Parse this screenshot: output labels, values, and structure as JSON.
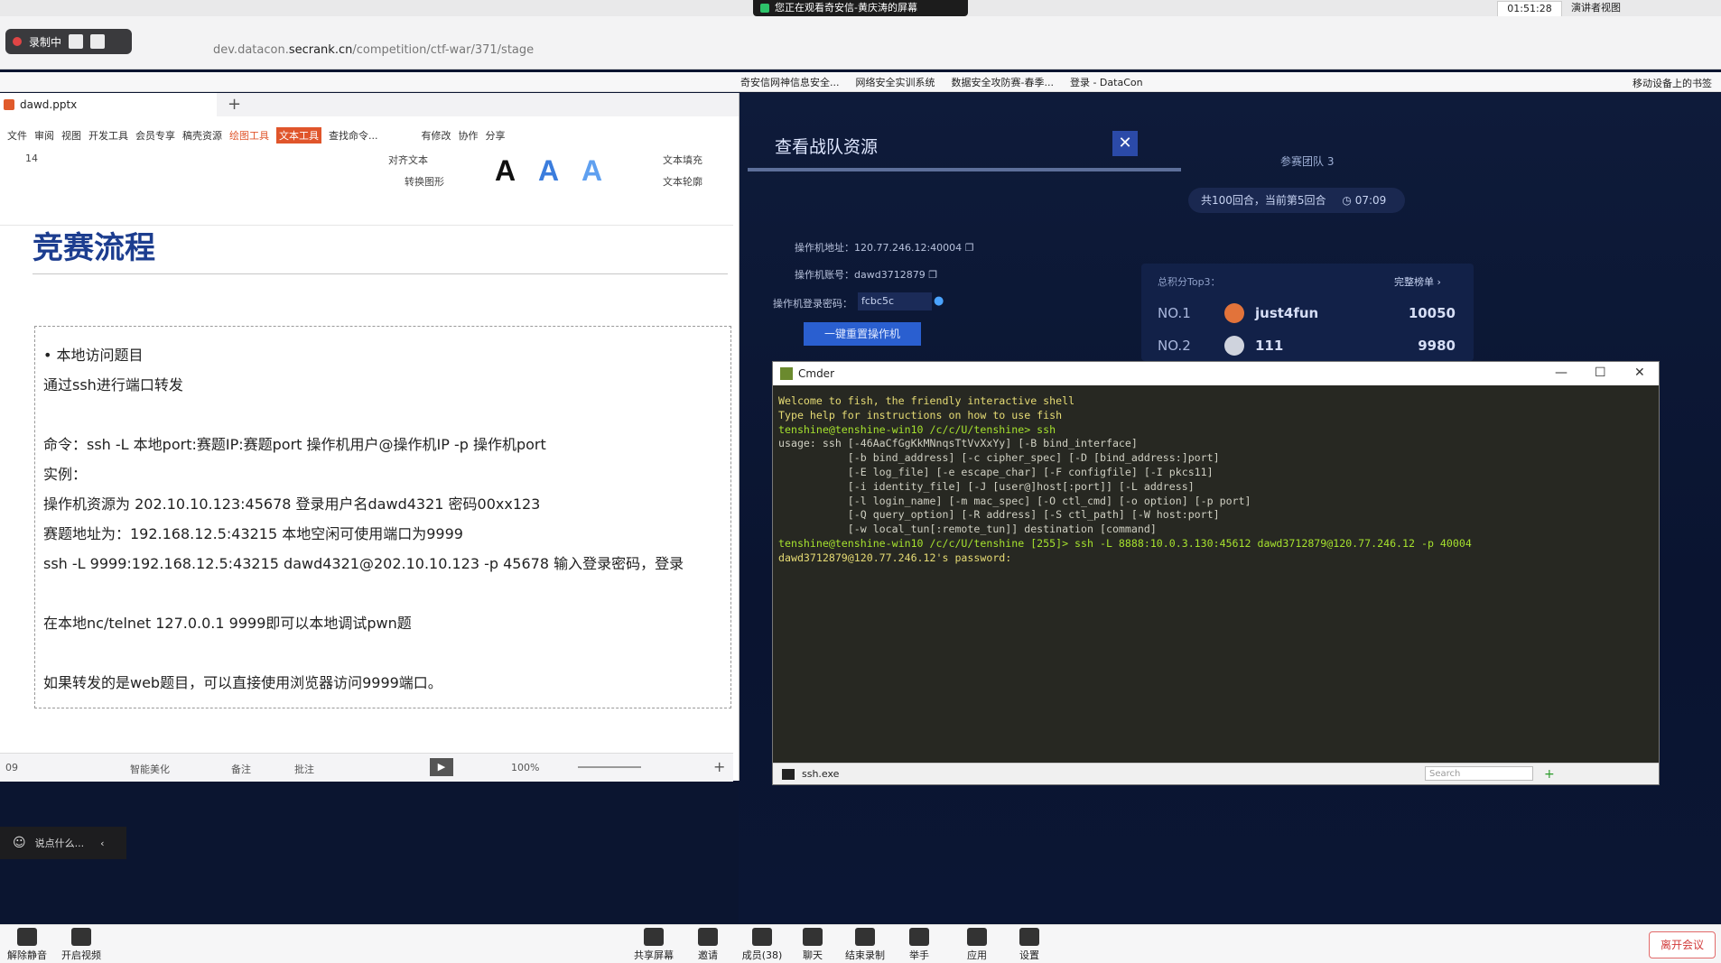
{
  "meeting": {
    "share_banner": "您正在观看奇安信-黄庆涛的屏幕",
    "clock": "01:51:28",
    "presenter_view": "演讲者视图",
    "recording_label": "录制中",
    "chat_placeholder": "说点什么...",
    "leave_label": "离开会议",
    "toolbar": [
      {
        "label": "解除静音",
        "icon": "mic-muted-icon"
      },
      {
        "label": "开启视频",
        "icon": "video-off-icon"
      },
      {
        "label": "共享屏幕",
        "icon": "share-screen-icon"
      },
      {
        "label": "邀请",
        "icon": "invite-icon"
      },
      {
        "label": "成员(38)",
        "icon": "members-icon"
      },
      {
        "label": "聊天",
        "icon": "chat-icon"
      },
      {
        "label": "结束录制",
        "icon": "stop-record-icon"
      },
      {
        "label": "举手",
        "icon": "raise-hand-icon"
      },
      {
        "label": "应用",
        "icon": "apps-icon"
      },
      {
        "label": "设置",
        "icon": "settings-icon"
      }
    ]
  },
  "browser": {
    "url_prefix": "dev.datacon.",
    "url_domain": "secrank.cn",
    "url_path": "/competition/ctf-war/371/stage",
    "bookmarks": [
      "奇安信网神信息安全...",
      "网络安全实训系统",
      "数据安全攻防赛-春季...",
      "登录 - DataCon"
    ],
    "bookmark_mobile": "移动设备上的书签"
  },
  "ctf_page": {
    "panel_title": "查看战队资源",
    "team_label": "参赛团队 3",
    "stat_text": "共100回合，当前第5回合",
    "timer": "07:09",
    "op_addr_label": "操作机地址：",
    "op_addr": "120.77.246.12:40004",
    "op_user_label": "操作机账号：",
    "op_user": "dawd3712879",
    "op_pwd_label": "操作机登录密码：",
    "op_pwd": "fcbc5c",
    "login_button": "一键重置操作机",
    "rank_title": "总积分Top3：",
    "rank_more": "完整榜单",
    "ranking": [
      {
        "no": "NO.1",
        "name": "just4fun",
        "score": "10050",
        "avatar_color": "#e2733a"
      },
      {
        "no": "NO.2",
        "name": "111",
        "score": "9980",
        "avatar_color": "#cfd3dd"
      }
    ]
  },
  "ppt": {
    "filename": "dawd.pptx",
    "menu": [
      "文件",
      "审阅",
      "视图",
      "开发工具",
      "会员专享",
      "稿壳资源",
      "绘图工具",
      "文本工具",
      "查找命令...",
      "有修改",
      "协作",
      "分享"
    ],
    "font_size": "14",
    "align_text": "对齐文本",
    "text_fill": "文本填充",
    "text_outline": "文本轮廓",
    "convert_shape": "转换图形",
    "zoom": "100%",
    "smart_beautify": "智能美化",
    "notes": "备注",
    "comments": "批注",
    "slide_no": "09",
    "slide": {
      "title": "竞赛流程",
      "lines": [
        "•    本地访问题目",
        "通过ssh进行端口转发",
        "",
        "命令：ssh -L 本地port:赛题IP:赛题port 操作机用户@操作机IP -p 操作机port",
        "实例：",
        "操作机资源为 202.10.10.123:45678 登录用户名dawd4321 密码00xx123",
        "赛题地址为：192.168.12.5:43215 本地空闲可使用端口为9999",
        "ssh -L 9999:192.168.12.5:43215 dawd4321@202.10.10.123 -p 45678 输入登录密码，登录",
        "",
        "在本地nc/telnet  127.0.0.1 9999即可以本地调试pwn题",
        "",
        "如果转发的是web题目，可以直接使用浏览器访问9999端口。"
      ]
    }
  },
  "cmder": {
    "title": "Cmder",
    "tab": "ssh.exe",
    "search_placeholder": "Search",
    "lines": [
      {
        "cls": "t-y",
        "text": "Welcome to fish, the friendly interactive shell"
      },
      {
        "cls": "t-y",
        "text": "Type help for instructions on how to use fish"
      },
      {
        "cls": "t-g",
        "text": "tenshine@tenshine-win10 /c/c/U/tenshine> ssh"
      },
      {
        "cls": "",
        "text": "usage: ssh [-46AaCfGgKkMNnqsTtVvXxYy] [-B bind_interface]"
      },
      {
        "cls": "",
        "text": "           [-b bind_address] [-c cipher_spec] [-D [bind_address:]port]"
      },
      {
        "cls": "",
        "text": "           [-E log_file] [-e escape_char] [-F configfile] [-I pkcs11]"
      },
      {
        "cls": "",
        "text": "           [-i identity_file] [-J [user@]host[:port]] [-L address]"
      },
      {
        "cls": "",
        "text": "           [-l login_name] [-m mac_spec] [-O ctl_cmd] [-o option] [-p port]"
      },
      {
        "cls": "",
        "text": "           [-Q query_option] [-R address] [-S ctl_path] [-W host:port]"
      },
      {
        "cls": "",
        "text": "           [-w local_tun[:remote_tun]] destination [command]"
      },
      {
        "cls": "t-g",
        "text": "tenshine@tenshine-win10 /c/c/U/tenshine [255]> ssh -L 8888:10.0.3.130:45612 dawd3712879@120.77.246.12 -p 40004"
      },
      {
        "cls": "t-y",
        "text": "dawd3712879@120.77.246.12's password:"
      }
    ]
  }
}
